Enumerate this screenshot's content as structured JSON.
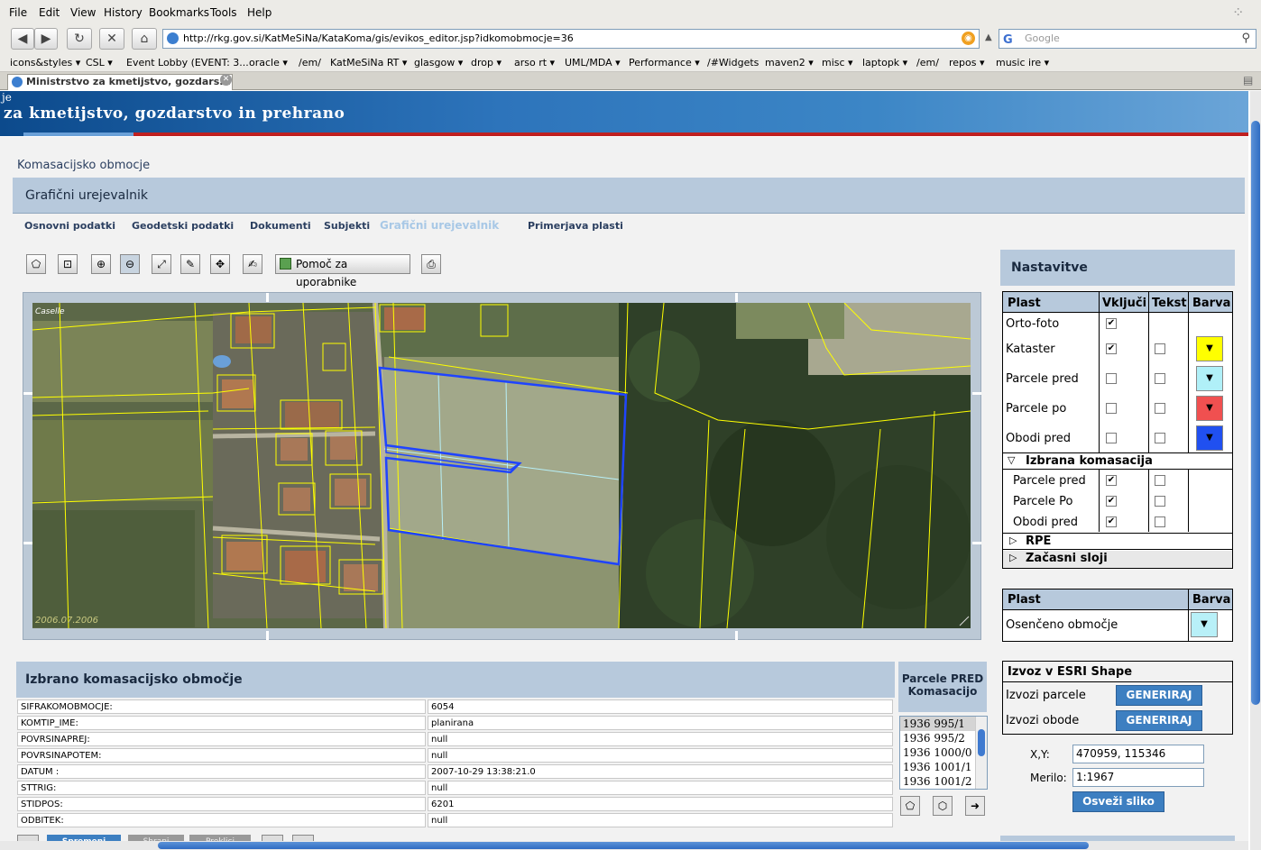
{
  "browser": {
    "menu": [
      "File",
      "Edit",
      "View",
      "History",
      "Bookmarks",
      "Tools",
      "Help"
    ],
    "url": "http://rkg.gov.si/KatMeSiNa/KataKoma/gis/evikos_editor.jsp?idkomobmocje=36",
    "search_placeholder": "Google",
    "bookmarks": [
      "icons&styles ▾",
      "CSL ▾",
      "Event Lobby (EVENT: 3...",
      "oracle ▾",
      "/em/",
      "KatMeSiNa RT ▾",
      "glasgow ▾",
      "drop ▾",
      "arso rt ▾",
      "UML/MDA ▾",
      "Performance ▾",
      "/#Widgets",
      "maven2 ▾",
      "misc ▾",
      "laptopk ▾",
      "/em/",
      "repos ▾",
      "music ire ▾"
    ],
    "tab_title": "Ministrstvo za kmetijstvo, gozdars..."
  },
  "banner": {
    "line1": "je",
    "line2": "za kmetijstvo, gozdarstvo in prehrano"
  },
  "page_title": "Komasacijsko obmocje",
  "editor_title": "Grafični urejevalnik",
  "tabs": [
    "Osnovni podatki",
    "Geodetski podatki",
    "Dokumenti",
    "Subjekti",
    "Grafični urejevalnik",
    "Primerjava plasti"
  ],
  "toolbar": {
    "help_label": "Pomoč za uporabnike"
  },
  "map": {
    "label": "Caselle",
    "date": "2006.07.2006"
  },
  "settings": {
    "title": "Nastavitve",
    "headers": {
      "plast": "Plast",
      "vklj": "Vključi",
      "tekst": "Tekst",
      "barva": "Barva"
    },
    "layers": [
      {
        "name": "Orto-foto",
        "on": true,
        "text": null,
        "color": null
      },
      {
        "name": "Kataster",
        "on": true,
        "text": false,
        "color": "#ffff00"
      },
      {
        "name": "Parcele pred",
        "on": false,
        "text": false,
        "color": "#b0f0f8"
      },
      {
        "name": "Parcele po",
        "on": false,
        "text": false,
        "color": "#f05050"
      },
      {
        "name": "Obodi pred",
        "on": false,
        "text": false,
        "color": "#2050f0"
      }
    ],
    "group_label": "Izbrana komasacija",
    "group_layers": [
      {
        "name": "Parcele pred",
        "on": true,
        "text": false
      },
      {
        "name": "Parcele Po",
        "on": true,
        "text": false
      },
      {
        "name": "Obodi pred",
        "on": true,
        "text": false
      }
    ],
    "rpe": "RPE",
    "temp": "Začasni sloji",
    "shade_headers": {
      "plast": "Plast",
      "barva": "Barva"
    },
    "shade_label": "Osenčeno območje",
    "shade_color": "#b8f0f8"
  },
  "export": {
    "title": "Izvoz v ESRI Shape",
    "row1": "Izvozi parcele",
    "row2": "Izvozi obode",
    "button": "GENERIRAJ"
  },
  "coords": {
    "xy_label": "X,Y:",
    "xy_value": "470959, 115346",
    "scale_label": "Merilo:",
    "scale_value": "1:1967",
    "refresh": "Osveži sliko"
  },
  "info": {
    "title": "Izbrano komasacijsko območje",
    "rows": [
      {
        "k": "SIFRAKOMOBMOCJE:",
        "v": "6054"
      },
      {
        "k": "KOMTIP_IME:",
        "v": "planirana"
      },
      {
        "k": "POVRSINAPREJ:",
        "v": "null"
      },
      {
        "k": "POVRSINAPOTEM:",
        "v": "null"
      },
      {
        "k": "DATUM :",
        "v": "2007-10-29 13:38:21.0"
      },
      {
        "k": "STTRIG:",
        "v": "null"
      },
      {
        "k": "STIDPOS:",
        "v": "6201"
      },
      {
        "k": "ODBITEK:",
        "v": "null"
      }
    ]
  },
  "parcels": {
    "title": "Parcele PRED Komasacijo",
    "items": [
      "1936 995/1",
      "1936 995/2",
      "1936 1000/0",
      "1936 1001/1",
      "1936 1001/2"
    ]
  },
  "bottom_buttons": [
    "Spremeni",
    "Shrani",
    "Preklici"
  ]
}
